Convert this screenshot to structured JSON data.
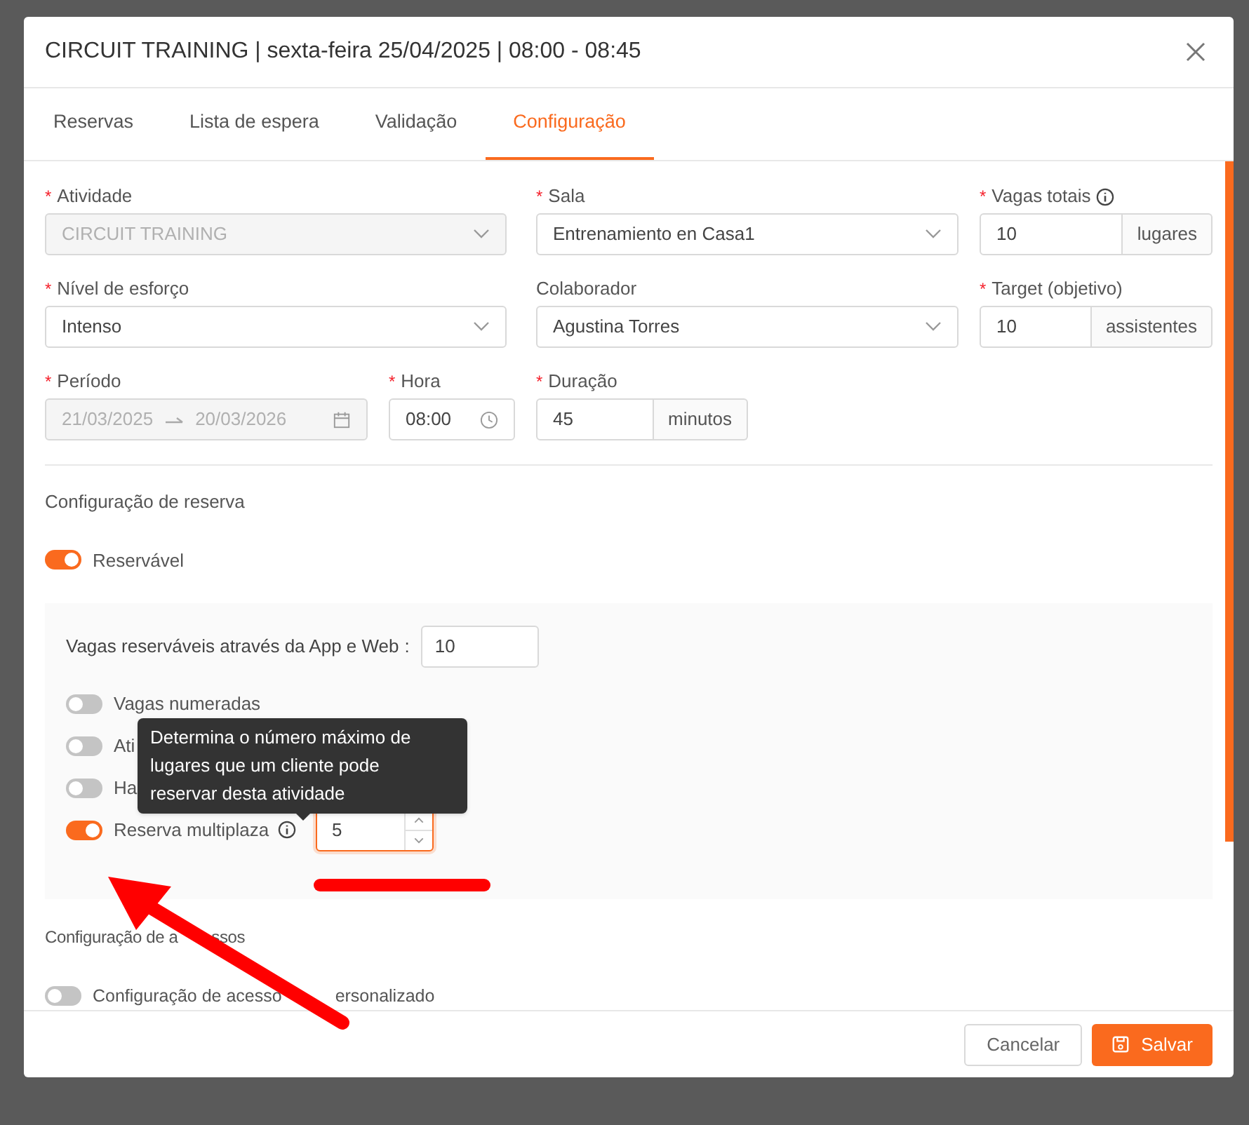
{
  "dialog": {
    "title": "CIRCUIT TRAINING | sexta-feira 25/04/2025 | 08:00 - 08:45"
  },
  "tabs": [
    {
      "label": "Reservas",
      "selected": false
    },
    {
      "label": "Lista de espera",
      "selected": false
    },
    {
      "label": "Validação",
      "selected": false
    },
    {
      "label": "Configuração",
      "selected": true
    }
  ],
  "field_rows": [
    [
      {
        "kind": "select",
        "required_mark": "*",
        "label": "Atividade",
        "value": "CIRCUIT TRAINING",
        "disabled": true
      },
      {
        "kind": "select",
        "required_mark": "*",
        "label": "Sala",
        "value": "Entrenamiento en Casa1",
        "disabled": false
      },
      {
        "kind": "addon",
        "required_mark": "*",
        "label": "Vagas totais",
        "info": true,
        "value": "10",
        "addon": "lugares"
      }
    ],
    [
      {
        "kind": "select",
        "required_mark": "*",
        "label": "Nível de esforço",
        "value": "Intenso",
        "disabled": false
      },
      {
        "kind": "select",
        "label": "Colaborador",
        "value": "Agustina Torres",
        "disabled": false
      },
      {
        "kind": "addon",
        "required_mark": "*",
        "label": "Target (objetivo)",
        "value": "10",
        "addon": "assistentes"
      }
    ],
    [
      {
        "kind": "range",
        "required_mark": "*",
        "label": "Período",
        "start": "21/03/2025",
        "end": "20/03/2026",
        "disabled": true
      },
      {
        "kind": "time",
        "required_mark": "*",
        "label": "Hora",
        "value": "08:00"
      },
      {
        "kind": "addon",
        "required_mark": "*",
        "label": "Duração",
        "value": "45",
        "addon": "minutos"
      }
    ]
  ],
  "booking": {
    "title": "Configuração de reserva",
    "toggle": {
      "label": "Reservável",
      "on": true
    },
    "app_places": {
      "label": "Vagas reserváveis através da App e Web",
      "separator": ":",
      "value": "10"
    },
    "options": [
      {
        "label": "Vagas numeradas",
        "on": false
      },
      {
        "label": "Ati",
        "on": false
      },
      {
        "label": "Ha",
        "on": false
      },
      {
        "label": "Reserva multiplaza",
        "on": true,
        "info": true,
        "value": "5",
        "focused": true
      }
    ],
    "tooltip": [
      "Determina o número máximo de",
      "lugares que um cliente pode",
      "reservar desta atividade"
    ]
  },
  "access": {
    "title": "Configuração de a",
    "title_end": "ssos",
    "toggle": {
      "label": "Configuração de acesso",
      "label_end": "ersonalizado",
      "on": false
    }
  },
  "buttons": [
    {
      "kind": "secondary",
      "label": "Cancelar"
    },
    {
      "kind": "primary",
      "label": "Salvar"
    }
  ]
}
